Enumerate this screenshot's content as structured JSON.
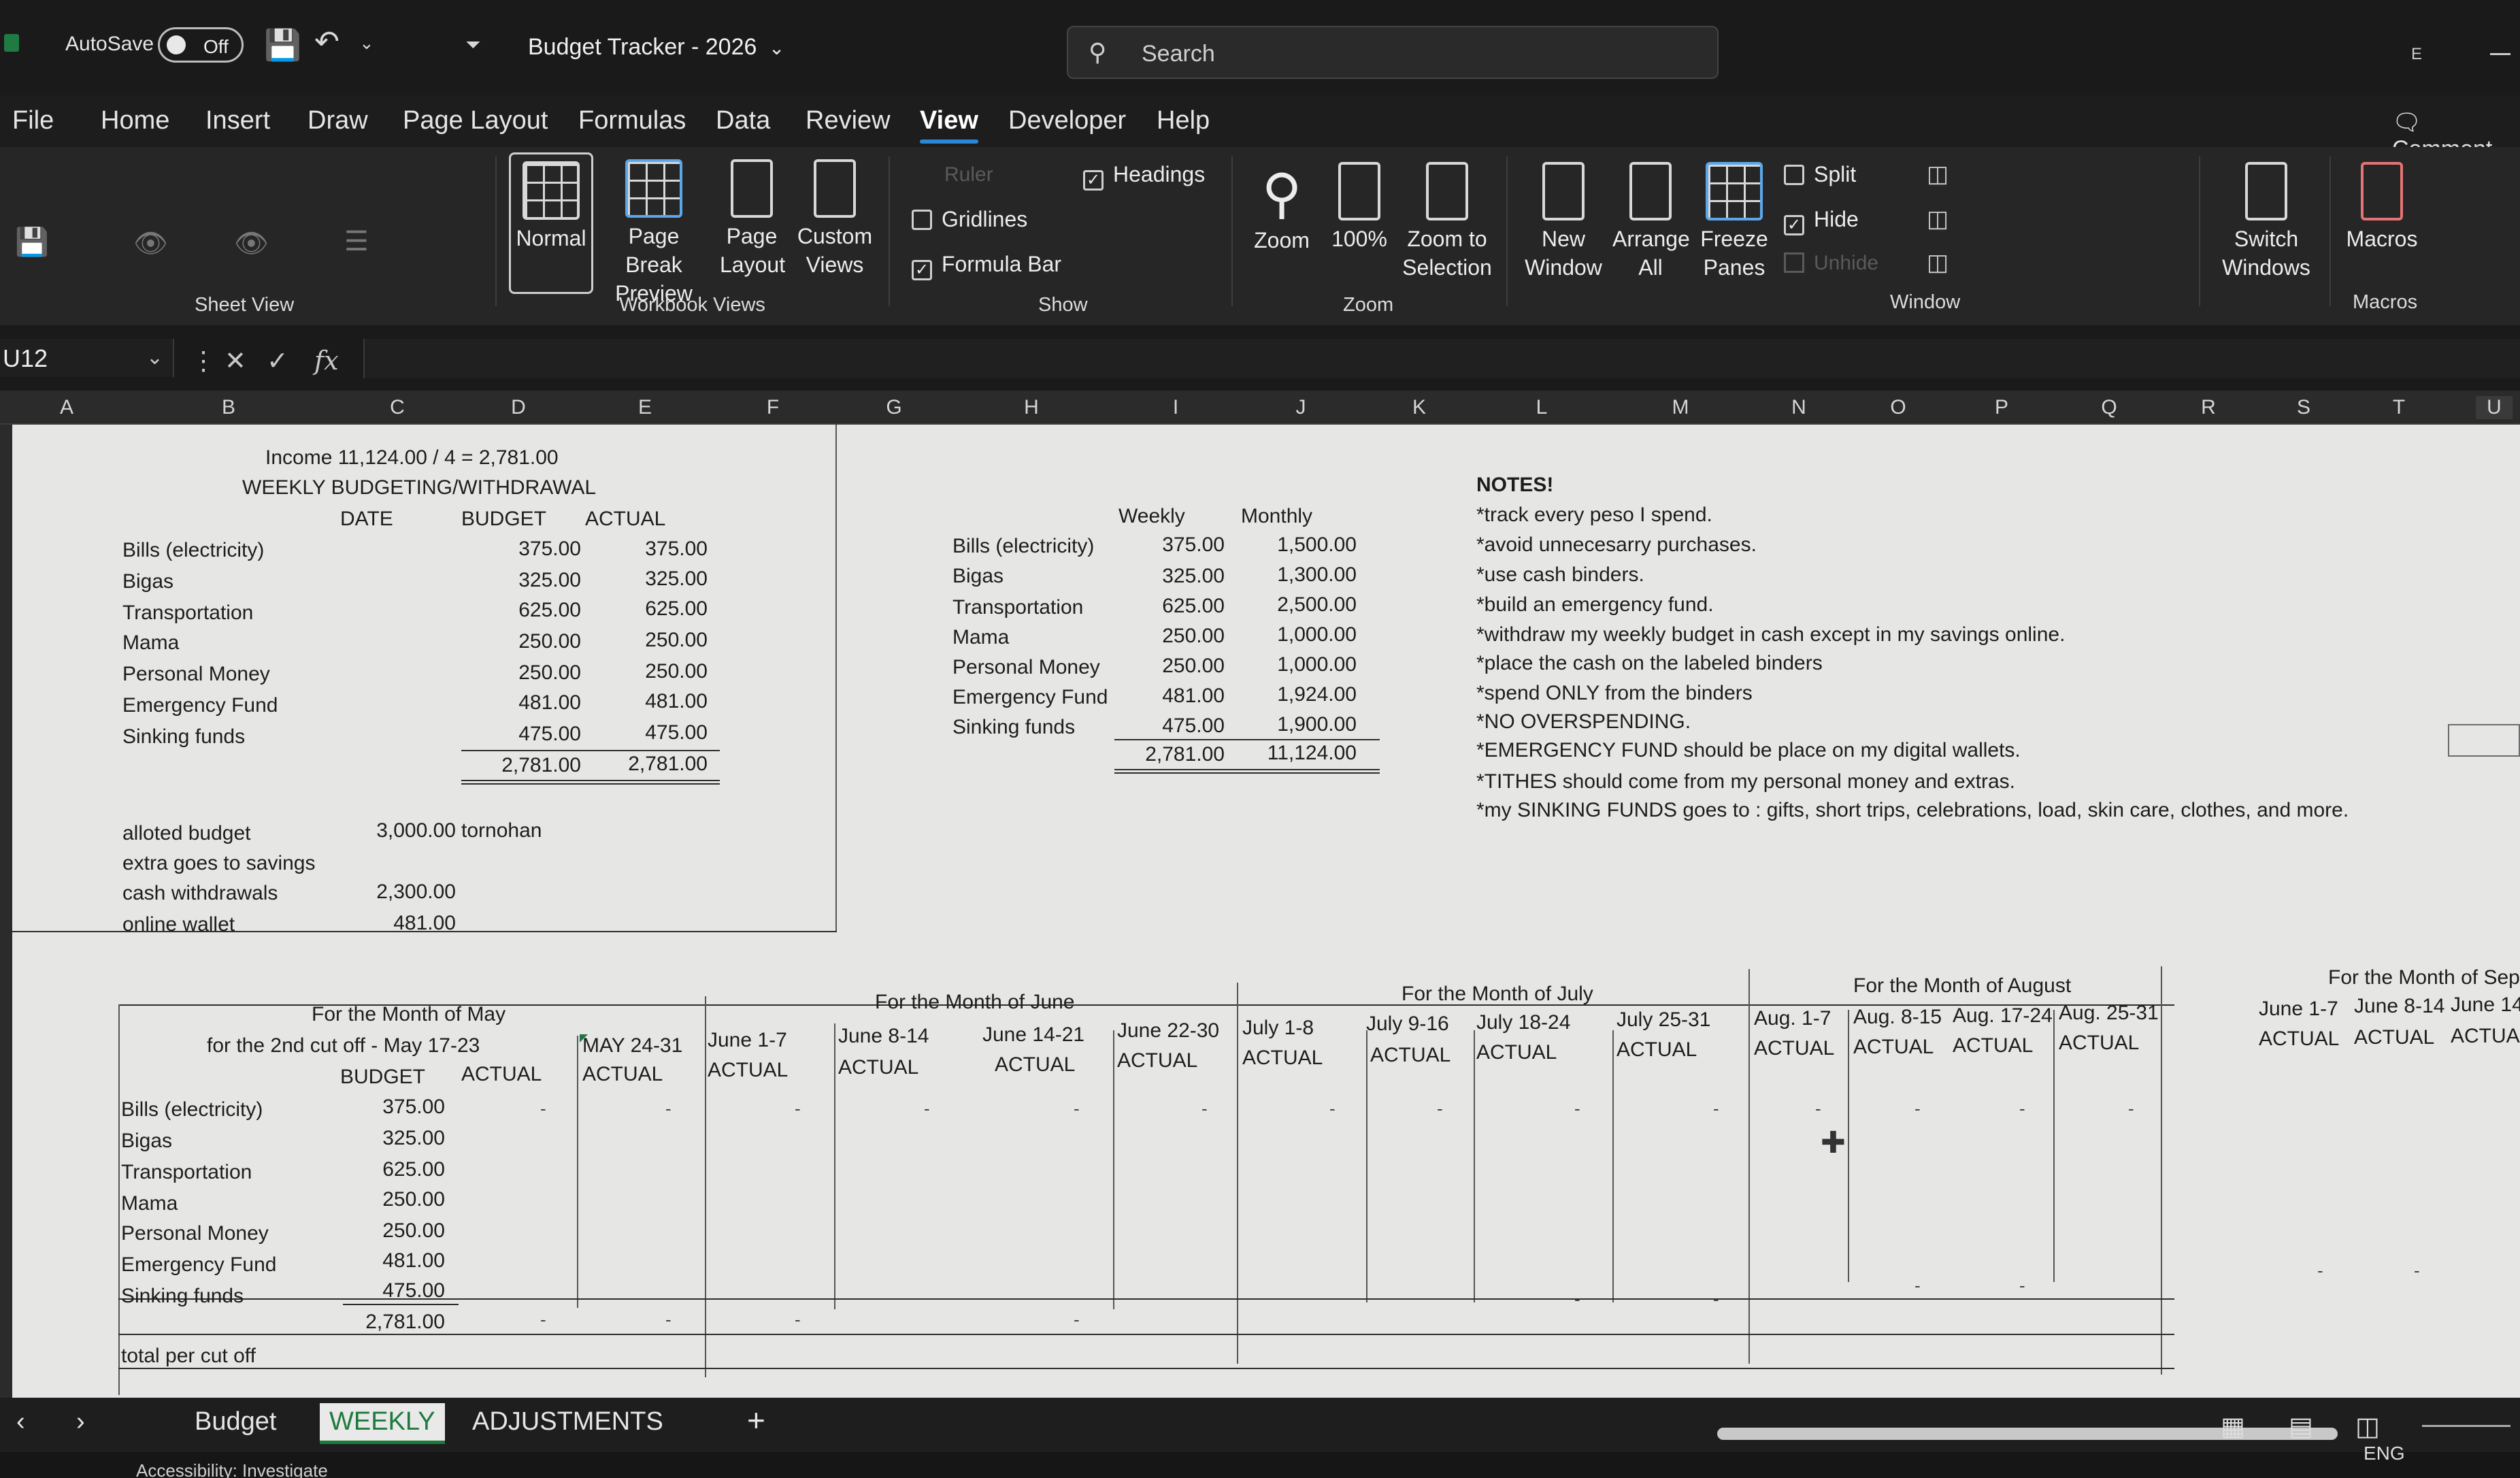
{
  "titlebar": {
    "autosave_label": "AutoSave",
    "autosave_state": "Off",
    "doc_title": "Budget Tracker - 2026",
    "search_placeholder": "Search",
    "profile_initial": "E"
  },
  "menu": [
    "File",
    "Home",
    "Insert",
    "Draw",
    "Page Layout",
    "Formulas",
    "Data",
    "Review",
    "View",
    "Developer",
    "Help"
  ],
  "menu_active": "View",
  "comments_label": "Comment",
  "ribbon": {
    "sheet_view_label": "Sheet View",
    "workbook_views_label": "Workbook Views",
    "normal": "Normal",
    "page_break_1": "Page Break",
    "page_break_2": "Preview",
    "page_layout_1": "Page",
    "page_layout_2": "Layout",
    "custom_views_1": "Custom",
    "custom_views_2": "Views",
    "show_label": "Show",
    "ruler": "Ruler",
    "headings": "Headings",
    "gridlines": "Gridlines",
    "formula_bar": "Formula Bar",
    "zoom_label": "Zoom",
    "zoom": "Zoom",
    "zoom_100": "100%",
    "zoom_sel_1": "Zoom to",
    "zoom_sel_2": "Selection",
    "window_label": "Window",
    "new_window_1": "New",
    "new_window_2": "Window",
    "arrange_1": "Arrange",
    "arrange_2": "All",
    "freeze_1": "Freeze",
    "freeze_2": "Panes",
    "split": "Split",
    "hide": "Hide",
    "unhide": "Unhide",
    "switch_1": "Switch",
    "switch_2": "Windows",
    "macros_label": "Macros",
    "macros": "Macros"
  },
  "formula": {
    "name_box": "U12",
    "fx": "fx"
  },
  "columns": [
    "A",
    "B",
    "C",
    "D",
    "E",
    "F",
    "G",
    "H",
    "I",
    "J",
    "K",
    "L",
    "M",
    "N",
    "O",
    "P",
    "Q",
    "R",
    "S",
    "T",
    "U"
  ],
  "weekly": {
    "income_line": "Income 11,124.00 / 4 = 2,781.00",
    "heading": "WEEKLY BUDGETING/WITHDRAWAL",
    "col_date": "DATE",
    "col_budget": "BUDGET",
    "col_actual": "ACTUAL",
    "rows": [
      {
        "label": "Bills (electricity)",
        "budget": "375.00",
        "actual": "375.00"
      },
      {
        "label": "Bigas",
        "budget": "325.00",
        "actual": "325.00"
      },
      {
        "label": "Transportation",
        "budget": "625.00",
        "actual": "625.00"
      },
      {
        "label": "Mama",
        "budget": "250.00",
        "actual": "250.00"
      },
      {
        "label": "Personal Money",
        "budget": "250.00",
        "actual": "250.00"
      },
      {
        "label": "Emergency Fund",
        "budget": "481.00",
        "actual": "481.00"
      },
      {
        "label": "Sinking funds",
        "budget": "475.00",
        "actual": "475.00"
      }
    ],
    "total_budget": "2,781.00",
    "total_actual": "2,781.00",
    "alloted_label": "alloted budget",
    "alloted_value": "3,000.00",
    "alloted_note": "tornohan",
    "extra_label": "extra goes to savings",
    "cash_label": "cash withdrawals",
    "cash_value": "2,300.00",
    "online_label": "online wallet",
    "online_value": "481.00"
  },
  "monthly": {
    "col_weekly": "Weekly",
    "col_monthly": "Monthly",
    "rows": [
      {
        "label": "Bills (electricity)",
        "weekly": "375.00",
        "monthly": "1,500.00"
      },
      {
        "label": "Bigas",
        "weekly": "325.00",
        "monthly": "1,300.00"
      },
      {
        "label": "Transportation",
        "weekly": "625.00",
        "monthly": "2,500.00"
      },
      {
        "label": "Mama",
        "weekly": "250.00",
        "monthly": "1,000.00"
      },
      {
        "label": "Personal Money",
        "weekly": "250.00",
        "monthly": "1,000.00"
      },
      {
        "label": "Emergency Fund",
        "weekly": "481.00",
        "monthly": "1,924.00"
      },
      {
        "label": "Sinking funds",
        "weekly": "475.00",
        "monthly": "1,900.00"
      }
    ],
    "total_weekly": "2,781.00",
    "total_monthly": "11,124.00"
  },
  "notes": {
    "title": "NOTES!",
    "items": [
      "*track every peso I spend.",
      "*avoid unnecesarry purchases.",
      "*use cash binders.",
      "*build an emergency fund.",
      "*withdraw my weekly budget in cash except in my savings online.",
      "*place the cash on the labeled binders",
      "*spend ONLY from the binders",
      "*NO OVERSPENDING.",
      "*EMERGENCY FUND should be place on my digital wallets.",
      "*TITHES should come from my personal money and extras.",
      "*my SINKING FUNDS goes to : gifts, short trips, celebrations, load, skin care, clothes, and more."
    ]
  },
  "tracker": {
    "may_title": "For the Month of May",
    "may_sub": "for the 2nd cut off - May 17-23",
    "col_budget": "BUDGET",
    "col_actual": "ACTUAL",
    "rows": [
      {
        "label": "Bills (electricity)",
        "budget": "375.00"
      },
      {
        "label": "Bigas",
        "budget": "325.00"
      },
      {
        "label": "Transportation",
        "budget": "625.00"
      },
      {
        "label": "Mama",
        "budget": "250.00"
      },
      {
        "label": "Personal Money",
        "budget": "250.00"
      },
      {
        "label": "Emergency Fund",
        "budget": "481.00"
      },
      {
        "label": "Sinking funds",
        "budget": "475.00"
      }
    ],
    "total_budget": "2,781.00",
    "total_label": "total per cut off",
    "june_title": "For the Month of June",
    "july_title": "For the Month of July",
    "aug_title": "For the Month of August",
    "sept_title": "For the Month of Septe",
    "periods": [
      "MAY 24-31",
      "June 1-7",
      "June 8-14",
      "June 14-21",
      "June 22-30",
      "July 1-8",
      "July  9-16",
      "July 18-24",
      "July 25-31",
      "Aug. 1-7",
      "Aug. 8-15",
      "Aug. 17-24",
      "Aug. 25-31",
      "June 1-7",
      "June 8-14",
      "June 14-"
    ],
    "dash": "-"
  },
  "sheet_tabs": [
    "Budget",
    "WEEKLY",
    "ADJUSTMENTS"
  ],
  "sheet_tab_active": "WEEKLY",
  "add_sheet": "+",
  "status": {
    "accessibility": "Accessibility: Investigate",
    "lang": "ENG"
  },
  "colors": {
    "accent": "#2b88d8",
    "excel_green": "#1e7a3c",
    "sheet_bg": "#e6e7e5"
  }
}
